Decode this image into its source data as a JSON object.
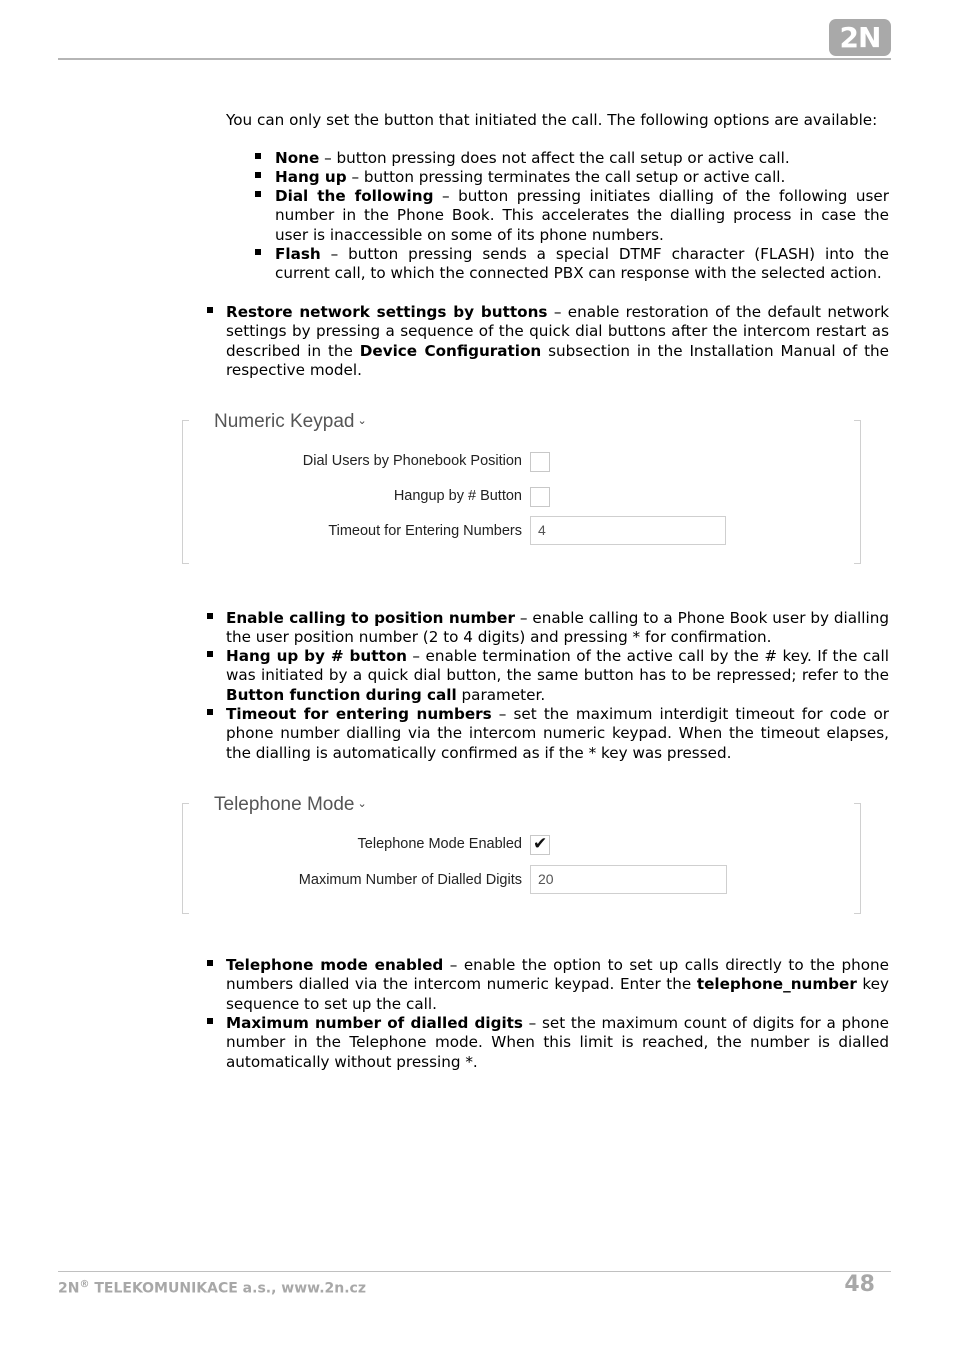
{
  "header": {
    "logo_text": "2N"
  },
  "intro": {
    "text": "You can only set the button that initiated the call. The following options are available:",
    "options": [
      {
        "term": "None",
        "desc": " – button pressing does not affect the call setup or active call."
      },
      {
        "term": "Hang up",
        "desc": " – button pressing terminates the call setup or active call."
      },
      {
        "term": "Dial the following",
        "desc": " – button pressing initiates dialling of the following user number in the Phone Book. This accelerates the dialling process in case the user is inaccessible on some of its phone numbers."
      },
      {
        "term": "Flash",
        "desc": " – button pressing sends a special DTMF character (FLASH) into the current call, to which the connected PBX can response with the selected action."
      }
    ]
  },
  "restore": {
    "term": "Restore network settings by buttons",
    "desc1": " – enable restoration of the default network settings by pressing a sequence of the quick dial buttons after the intercom restart as described in the ",
    "ref": "Device Configuration",
    "desc2": " subsection in the Installation Manual of the respective model."
  },
  "numeric_keypad": {
    "title": "Numeric Keypad",
    "fields": {
      "dial_by_position": {
        "label": "Dial Users by Phonebook Position",
        "checked": false
      },
      "hangup_hash": {
        "label": "Hangup by # Button",
        "checked": false
      },
      "timeout": {
        "label": "Timeout for Entering Numbers",
        "value": "4"
      }
    }
  },
  "keypad_desc": [
    {
      "term": "Enable calling to position number",
      "desc": " – enable calling to a Phone Book user by dialling the user position number (2 to 4 digits) and pressing * for confirmation."
    },
    {
      "term": "Hang up by # button",
      "desc": " – enable termination of the active call by the # key. If the call was initiated by a quick dial button, the same button has to be repressed; refer to the ",
      "ref": "Button function during call",
      "desc2": "  parameter."
    },
    {
      "term": "Timeout for entering numbers",
      "desc": " – set the maximum interdigit timeout for code or phone number dialling via the intercom numeric keypad. When the timeout elapses, the dialling is automatically confirmed as if the * key was pressed."
    }
  ],
  "telephone_mode": {
    "title": "Telephone Mode",
    "fields": {
      "enabled": {
        "label": "Telephone Mode Enabled",
        "checked": true
      },
      "max_digits": {
        "label": "Maximum Number of Dialled Digits",
        "value": "20"
      }
    }
  },
  "telephone_desc": [
    {
      "term": "Telephone mode enabled",
      "desc": " – enable the option to set up calls directly to the phone numbers dialled via the intercom numeric keypad. Enter the ",
      "ref": "telephone_number",
      "desc2": " key sequence to set up the call."
    },
    {
      "term": "Maximum number of dialled digits",
      "desc": " – set the maximum count of digits for a phone number in the Telephone mode. When this limit is reached, the number is dialled automatically without pressing *."
    }
  ],
  "footer": {
    "company_prefix": "2N",
    "registered": "®",
    "company_rest": " TELEKOMUNIKACE a.s., www.2n.cz",
    "page_number": "48"
  },
  "icons": {
    "chevron": "chevron-down-icon",
    "check": "checkmark-icon",
    "bullet": "square-bullet-icon"
  }
}
